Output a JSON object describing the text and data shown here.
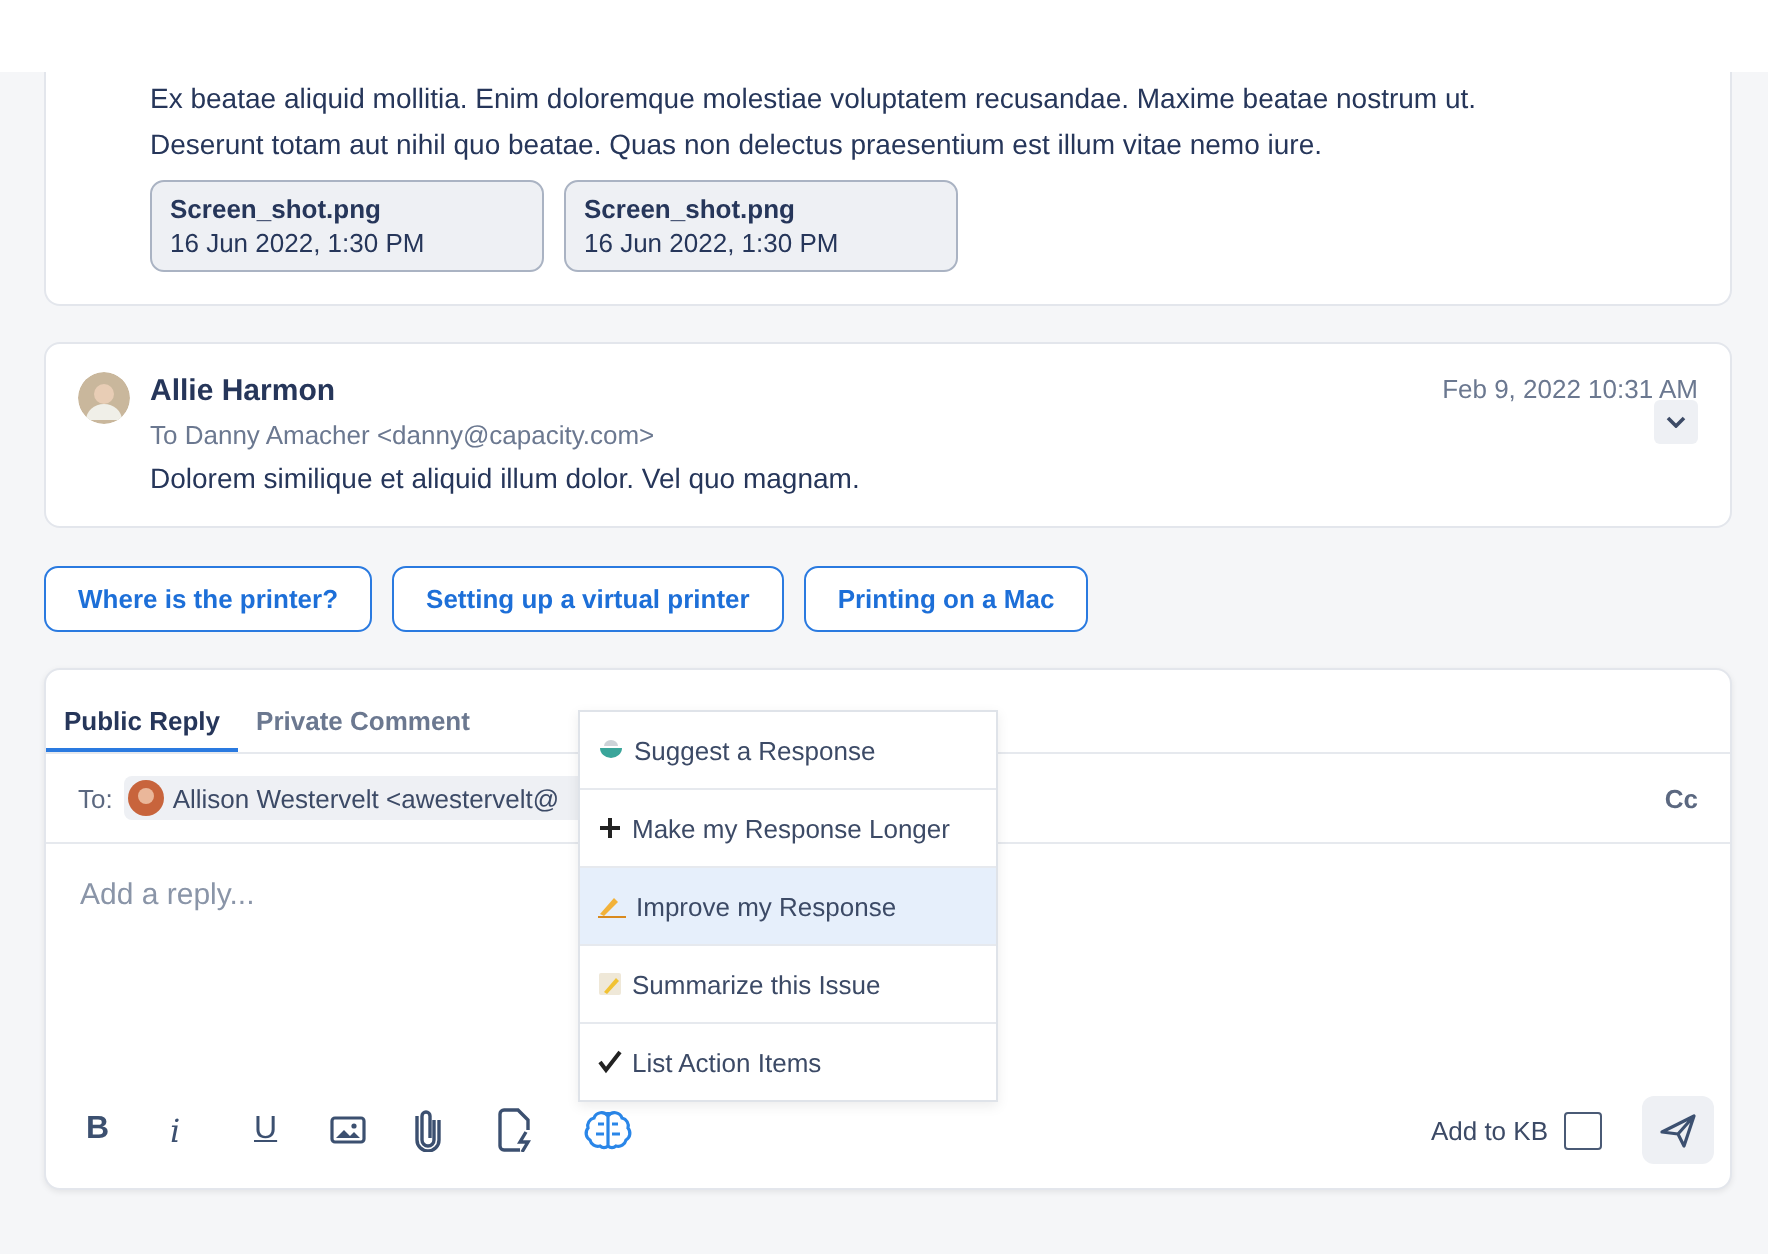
{
  "earlier_message": {
    "body_lines": [
      "Ex beatae aliquid mollitia. Enim doloremque molestiae voluptatem recusandae. Maxime beatae nostrum ut.",
      "Deserunt totam aut nihil quo beatae. Quas non delectus praesentium est illum vitae nemo iure."
    ],
    "attachments": [
      {
        "name": "Screen_shot.png",
        "date": "16 Jun 2022, 1:30 PM"
      },
      {
        "name": "Screen_shot.png",
        "date": "16 Jun 2022, 1:30 PM"
      }
    ]
  },
  "message": {
    "sender": "Allie Harmon",
    "to": "To Danny Amacher <danny@capacity.com>",
    "date": "Feb 9, 2022 10:31 AM",
    "body": "Dolorem similique et aliquid illum dolor. Vel quo magnam."
  },
  "suggestions": [
    "Where is the printer?",
    "Setting up a virtual printer",
    "Printing on a Mac"
  ],
  "reply": {
    "tabs": [
      {
        "label": "Public Reply",
        "selected": true
      },
      {
        "label": "Private Comment",
        "selected": false
      }
    ],
    "to_label": "To:",
    "recipient": "Allison Westervelt <awestervelt@",
    "cc": "Cc",
    "placeholder": "Add a reply...",
    "format_buttons": [
      "B",
      "i",
      "U"
    ],
    "add_to_kb": {
      "label": "Add to KB",
      "checked": false
    }
  },
  "ai_menu": [
    {
      "kind": "bowl",
      "label": "Suggest a Response",
      "selected": false
    },
    {
      "kind": "plus",
      "label": "Make my Response Longer",
      "selected": false
    },
    {
      "kind": "pen",
      "label": "Improve my Response",
      "selected": true
    },
    {
      "kind": "note",
      "label": "Summarize this Issue",
      "selected": false
    },
    {
      "kind": "check",
      "label": "List Action Items",
      "selected": false
    }
  ]
}
